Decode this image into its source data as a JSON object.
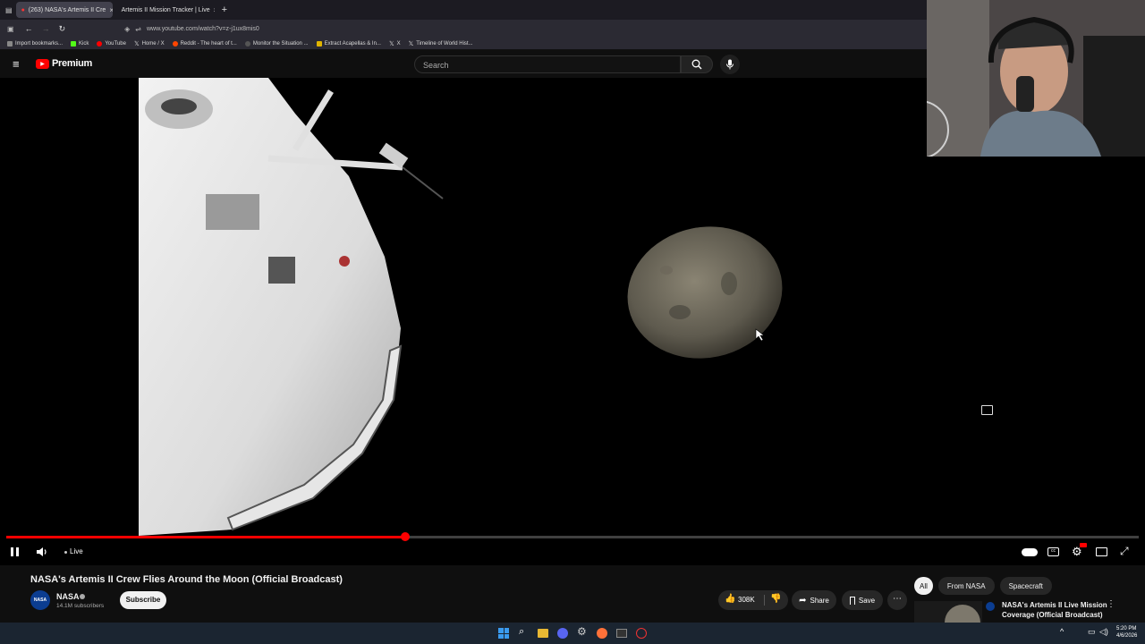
{
  "browser": {
    "tabs": [
      {
        "label": "(263) NASA's Artemis II Cre",
        "active": true
      },
      {
        "label": "Artemis II Mission Tracker | Live",
        "active": false
      }
    ],
    "url": "www.youtube.com/watch?v=z-j1ux8mis0",
    "bookmarks": [
      "Import bookmarks...",
      "Kick",
      "YouTube",
      "Home / X",
      "Reddit - The heart of t...",
      "Monitor the Situation ...",
      "Extract Acapellas & In...",
      "X",
      "Timeline of World Hist..."
    ]
  },
  "youtube": {
    "brand": "Premium",
    "search_placeholder": "Search"
  },
  "player": {
    "live_label": "Live",
    "progress_fraction": 0.352
  },
  "video": {
    "title": "NASA's Artemis II Crew Flies Around the Moon (Official Broadcast)",
    "channel": "NASA",
    "subscribers": "14.1M subscribers",
    "subscribe_label": "Subscribe",
    "likes": "308K",
    "share_label": "Share",
    "save_label": "Save"
  },
  "chips": [
    "All",
    "From NASA",
    "Spacecraft"
  ],
  "recommended": {
    "title_line1": "NASA's Artemis II Live Mission",
    "title_line2": "Coverage (Official Broadcast)"
  },
  "clock": {
    "time": "5:20 PM",
    "date": "4/6/2026"
  },
  "colors": {
    "accent": "#ff0000",
    "bg": "#0f0f0f"
  }
}
